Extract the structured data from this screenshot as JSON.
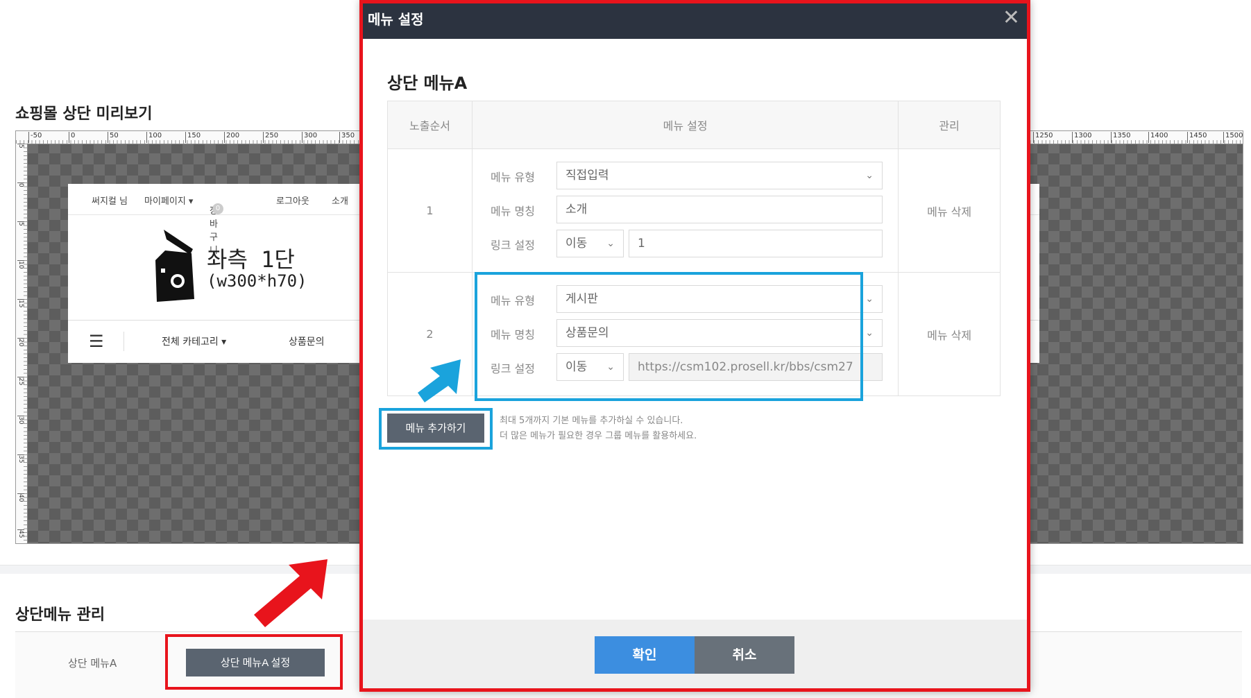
{
  "page": {
    "preview_title": "쇼핑몰 상단 미리보기",
    "manage_title": "상단메뉴 관리",
    "manage_row_label": "상단 메뉴A",
    "manage_row_button": "상단 메뉴A 설정"
  },
  "ruler": {
    "top_ticks": [
      "-50",
      "0",
      "50",
      "100",
      "150",
      "200",
      "250",
      "300",
      "350",
      "1250",
      "1300",
      "1350",
      "1400",
      "1450",
      "1500"
    ],
    "left_ticks": [
      "5",
      "0",
      "5",
      "10",
      "15",
      "20",
      "25",
      "30",
      "35",
      "40",
      "45"
    ]
  },
  "shop_preview": {
    "top_links": [
      "써지컬 님",
      "마이페이지 ▾",
      "장바구니",
      "로그아웃",
      "소개"
    ],
    "cart_count": "0",
    "logo_line1": "좌측 1단",
    "logo_line2": "(w300*h70)",
    "category_label": "전체 카테고리 ▾",
    "category_item": "상품문의"
  },
  "modal": {
    "title": "메뉴 설정",
    "close_glyph": "✕",
    "subtitle": "상단 메뉴A",
    "columns": [
      "노출순서",
      "메뉴 설정",
      "관리"
    ],
    "labels": {
      "menu_type": "메뉴 유형",
      "menu_name": "메뉴 명칭",
      "link_setting": "링크 설정"
    },
    "rows": [
      {
        "order": "1",
        "menu_type": "직접입력",
        "menu_name": "소개",
        "link_mode": "이동",
        "link_value": "1",
        "delete_label": "메뉴 삭제"
      },
      {
        "order": "2",
        "menu_type": "게시판",
        "menu_name": "상품문의",
        "link_mode": "이동",
        "link_value": "https://csm102.prosell.kr/bbs/csm27",
        "delete_label": "메뉴 삭제"
      }
    ],
    "add_button": "메뉴 추가하기",
    "help_line1": "최대 5개까지 기본 메뉴를 추가하실 수 있습니다.",
    "help_line2": "더 많은 메뉴가 필요한 경우 그룹 메뉴를 활용하세요.",
    "ok_button": "확인",
    "cancel_button": "취소"
  },
  "colors": {
    "header_bg": "#2c3340",
    "highlight_red": "#e8141c",
    "highlight_blue": "#1aa3dc",
    "ok_blue": "#3c8ee0",
    "cancel_gray": "#68717a"
  },
  "icons": [
    "close-icon",
    "chevron-down-icon",
    "hamburger-icon",
    "camera-logo-icon",
    "arrow-pointer-icon"
  ]
}
